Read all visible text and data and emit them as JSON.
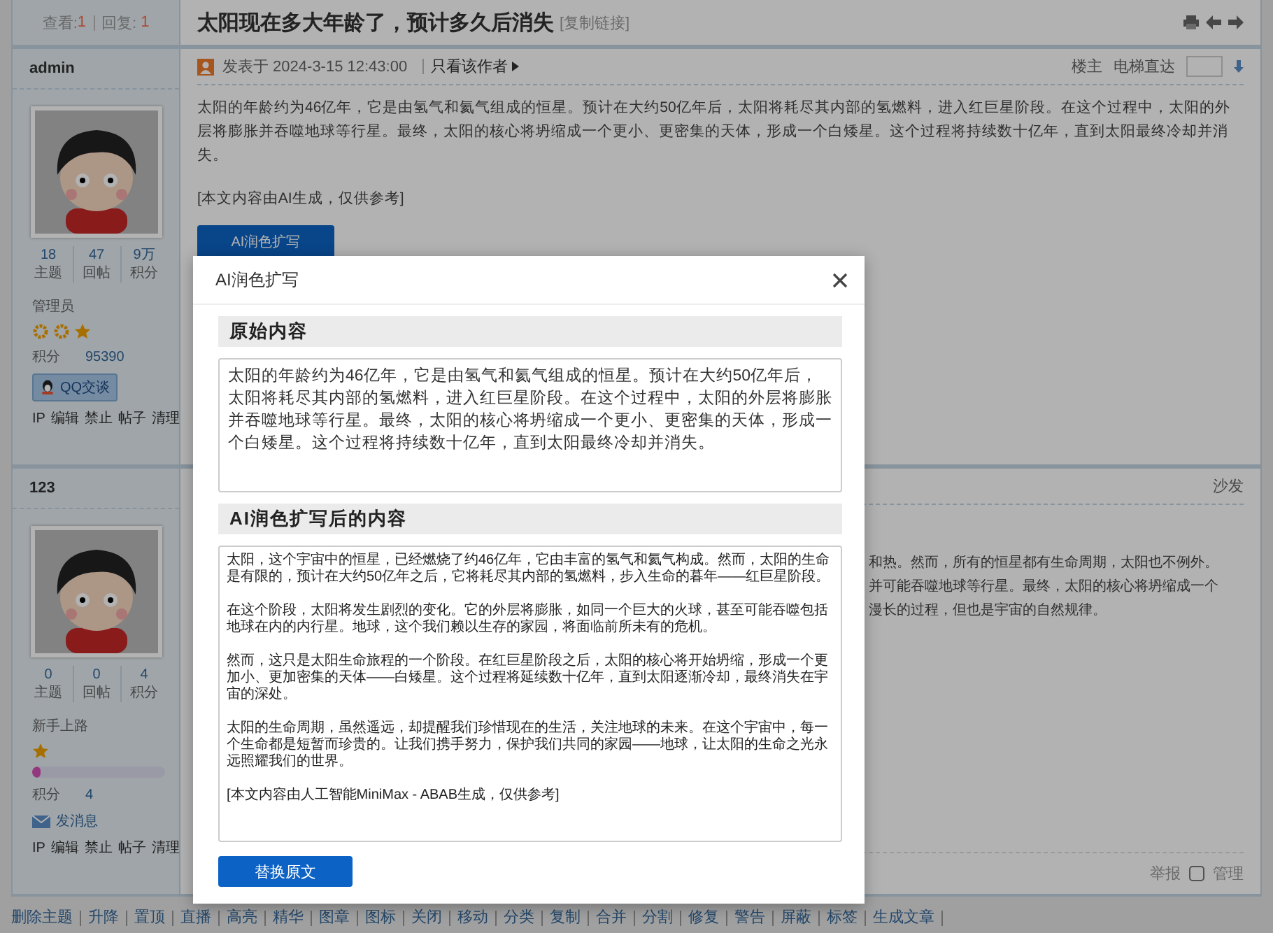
{
  "thread": {
    "views_label": "查看:",
    "views": "1",
    "replies_label": "回复:",
    "replies": "1",
    "title": "太阳现在多大年龄了，预计多久后消失",
    "copy_link": "[复制链接]"
  },
  "posts": [
    {
      "author": "admin",
      "stats": [
        {
          "value": "18",
          "label": "主题"
        },
        {
          "value": "47",
          "label": "回帖"
        },
        {
          "value": "9万",
          "label": "积分"
        }
      ],
      "rank": "管理员",
      "rank_icons": [
        {
          "kind": "sun"
        },
        {
          "kind": "sun"
        },
        {
          "kind": "star"
        }
      ],
      "points_label": "积分",
      "points": "95390",
      "contact": {
        "kind": "qq",
        "label": "QQ交谈"
      },
      "admin_links": [
        "IP",
        "编辑",
        "禁止",
        "帖子",
        "清理"
      ],
      "posted": "发表于 2024-3-15 12:43:00",
      "author_only": "只看该作者",
      "floor": "楼主",
      "jump_label": "电梯直达",
      "paragraphs": [
        "太阳的年龄约为46亿年，它是由氢气和氦气组成的恒星。预计在大约50亿年后，太阳将耗尽其内部的氢燃料，进入红巨星阶段。在这个过程中，太阳的外层将膨胀并吞噬地球等行星。最终，太阳的核心将坍缩成一个更小、更密集的天体，形成一个白矮星。这个过程将持续数十亿年，直到太阳最终冷却并消失。",
        "[本文内容由AI生成，仅供参考]"
      ],
      "ai_button": "AI润色扩写"
    },
    {
      "author": "123",
      "stats": [
        {
          "value": "0",
          "label": "主题"
        },
        {
          "value": "0",
          "label": "回帖"
        },
        {
          "value": "4",
          "label": "积分"
        }
      ],
      "rank": "新手上路",
      "rank_icons": [
        {
          "kind": "star"
        }
      ],
      "level": 0.06,
      "points_label": "积分",
      "points": "4",
      "contact": {
        "kind": "message",
        "label": "发消息"
      },
      "admin_links": [
        "IP",
        "编辑",
        "禁止",
        "帖子",
        "清理"
      ],
      "floor": "沙发",
      "visible_lines": [
        "和热。然而，所有的恒星都有生命周期，太阳也不例外。",
        "并可能吞噬地球等行星。最终，太阳的核心将坍缩成一个",
        "漫长的过程，但也是宇宙的自然规律。"
      ],
      "report": "举报",
      "manage": {
        "label": "管理",
        "checked": false
      }
    }
  ],
  "mod_bar": [
    "删除主题",
    "升降",
    "置顶",
    "直播",
    "高亮",
    "精华",
    "图章",
    "图标",
    "关闭",
    "移动",
    "分类",
    "复制",
    "合并",
    "分割",
    "修复",
    "警告",
    "屏蔽",
    "标签",
    "生成文章"
  ],
  "modal": {
    "title": "AI润色扩写",
    "original": {
      "heading": "原始内容",
      "text": "太阳的年龄约为46亿年，它是由氢气和氦气组成的恒星。预计在大约50亿年后，太阳将耗尽其内部的氢燃料，进入红巨星阶段。在这个过程中，太阳的外层将膨胀并吞噬地球等行星。最终，太阳的核心将坍缩成一个更小、更密集的天体，形成一个白矮星。这个过程将持续数十亿年，直到太阳最终冷却并消失。"
    },
    "expanded": {
      "heading": "AI润色扩写后的内容",
      "paragraphs": [
        "太阳，这个宇宙中的恒星，已经燃烧了约46亿年，它由丰富的氢气和氦气构成。然而，太阳的生命是有限的，预计在大约50亿年之后，它将耗尽其内部的氢燃料，步入生命的暮年——红巨星阶段。",
        "在这个阶段，太阳将发生剧烈的变化。它的外层将膨胀，如同一个巨大的火球，甚至可能吞噬包括地球在内的内行星。地球，这个我们赖以生存的家园，将面临前所未有的危机。",
        "然而，这只是太阳生命旅程的一个阶段。在红巨星阶段之后，太阳的核心将开始坍缩，形成一个更加小、更加密集的天体——白矮星。这个过程将延续数十亿年，直到太阳逐渐冷却，最终消失在宇宙的深处。",
        "太阳的生命周期，虽然遥远，却提醒我们珍惜现在的生活，关注地球的未来。在这个宇宙中，每一个生命都是短暂而珍贵的。让我们携手努力，保护我们共同的家园——地球，让太阳的生命之光永远照耀我们的世界。",
        "[本文内容由人工智能MiniMax - ABAB生成，仅供参考]"
      ]
    },
    "button": "替换原文"
  }
}
